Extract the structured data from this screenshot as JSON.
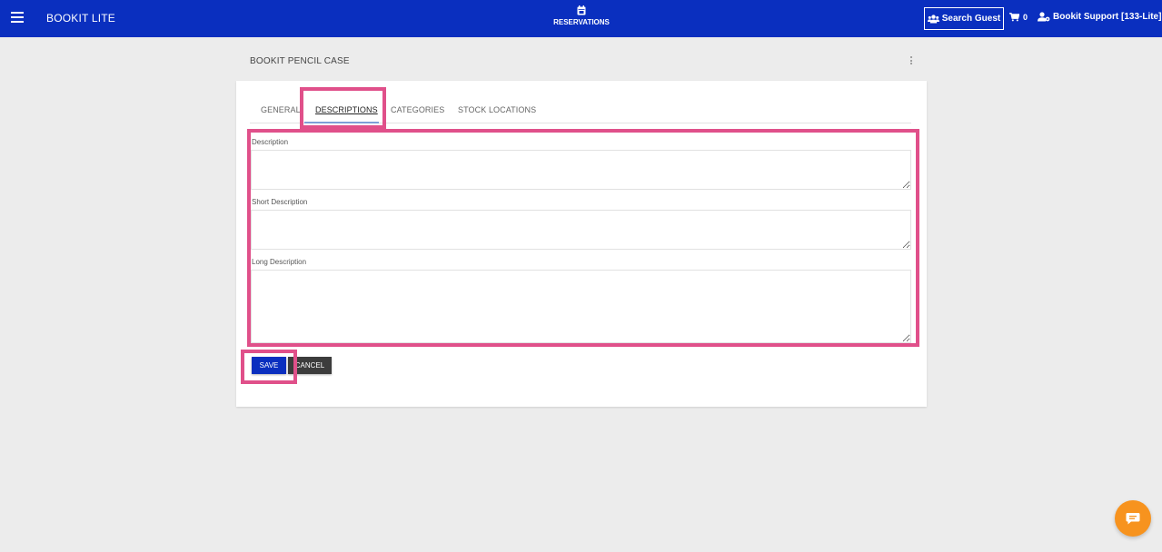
{
  "header": {
    "app_title": "BOOKIT LITE",
    "nav_reservations": "RESERVATIONS",
    "search_guest": "Search Guest",
    "cart_count": "0",
    "user_label": "Bookit Support [133-Lite]",
    "bar_color": "#0a2fbf"
  },
  "page": {
    "title": "BOOKIT PENCIL CASE"
  },
  "tabs": [
    {
      "label": "GENERAL",
      "active": false
    },
    {
      "label": "DESCRIPTIONS",
      "active": true
    },
    {
      "label": "CATEGORIES",
      "active": false
    },
    {
      "label": "STOCK LOCATIONS",
      "active": false
    }
  ],
  "form": {
    "description_label": "Description",
    "description_value": "",
    "short_description_label": "Short Description",
    "short_description_value": "",
    "long_description_label": "Long Description",
    "long_description_value": ""
  },
  "buttons": {
    "save": "SAVE",
    "cancel": "CANCEL"
  },
  "colors": {
    "highlight": "#e0508a",
    "primary": "#0a2fbf",
    "chat": "#f7931e"
  }
}
